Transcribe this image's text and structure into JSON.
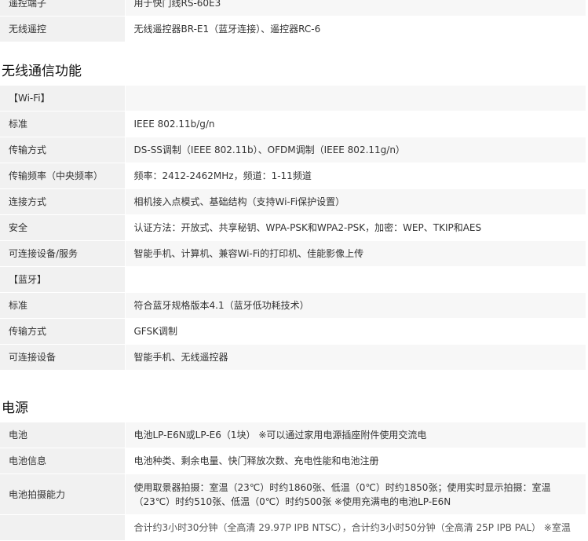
{
  "remote_table": [
    {
      "key": "遥控端子",
      "value": "用于快门线RS-60E3"
    },
    {
      "key": "无线遥控",
      "value": "无线遥控器BR-E1（蓝牙连接）、遥控器RC-6"
    }
  ],
  "wireless_section": {
    "title": "无线通信功能",
    "rows": [
      {
        "key": "【Wi-Fi】",
        "value": ""
      },
      {
        "key": "标准",
        "value": "IEEE 802.11b/g/n"
      },
      {
        "key": "传输方式",
        "value": "DS-SS调制（IEEE 802.11b）、OFDM调制（IEEE 802.11g/n）"
      },
      {
        "key": "传输频率（中央频率）",
        "value": "频率：2412-2462MHz，频道：1-11频道"
      },
      {
        "key": "连接方式",
        "value": "相机接入点模式、基础结构（支持Wi-Fi保护设置）"
      },
      {
        "key": "安全",
        "value": "认证方法：开放式、共享秘钥、WPA-PSK和WPA2-PSK，加密：WEP、TKIP和AES"
      },
      {
        "key": "可连接设备/服务",
        "value": "智能手机、计算机、兼容Wi-Fi的打印机、佳能影像上传"
      },
      {
        "key": "【蓝牙】",
        "value": ""
      },
      {
        "key": "标准",
        "value": "符合蓝牙规格版本4.1（蓝牙低功耗技术）"
      },
      {
        "key": "传输方式",
        "value": "GFSK调制"
      },
      {
        "key": "可连接设备",
        "value": "智能手机、无线遥控器"
      }
    ]
  },
  "power_section": {
    "title": "电源",
    "rows": [
      {
        "key": "电池",
        "value": "电池LP-E6N或LP-E6（1块） ※可以通过家用电源插座附件使用交流电"
      },
      {
        "key": "电池信息",
        "value": "电池种类、剩余电量、快门释放次数、充电性能和电池注册"
      },
      {
        "key": "电池拍摄能力",
        "value": "使用取景器拍摄：室温（23℃）时约1860张、低温（0℃）时约1850张；使用实时显示拍摄：室温（23℃）时约510张、低温（0℃）时约500张 ※使用充满电的电池LP-E6N"
      },
      {
        "key": "",
        "value": "合计约3小时30分钟（全高清 29.97P IPB NTSC），合计约3小时50分钟（全高清 25P IPB PAL） ※室温"
      }
    ]
  }
}
